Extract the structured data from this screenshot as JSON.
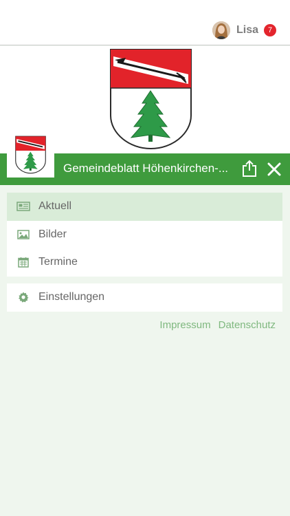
{
  "user": {
    "name": "Lisa",
    "notifications": "7"
  },
  "header": {
    "title": "Gemeindeblatt Höhenkirchen-..."
  },
  "menu": {
    "items": [
      {
        "label": "Aktuell",
        "icon": "newspaper-icon",
        "active": true
      },
      {
        "label": "Bilder",
        "icon": "image-icon",
        "active": false
      },
      {
        "label": "Termine",
        "icon": "calendar-icon",
        "active": false
      }
    ],
    "settings": {
      "label": "Einstellungen",
      "icon": "gear-icon"
    }
  },
  "footer": {
    "impressum": "Impressum",
    "datenschutz": "Datenschutz"
  },
  "colors": {
    "brand_green": "#3f9b3d",
    "active_bg": "#d9ecd8",
    "badge_red": "#e3252d",
    "crest_red": "#e2232a",
    "tree_green": "#2e9a48"
  }
}
